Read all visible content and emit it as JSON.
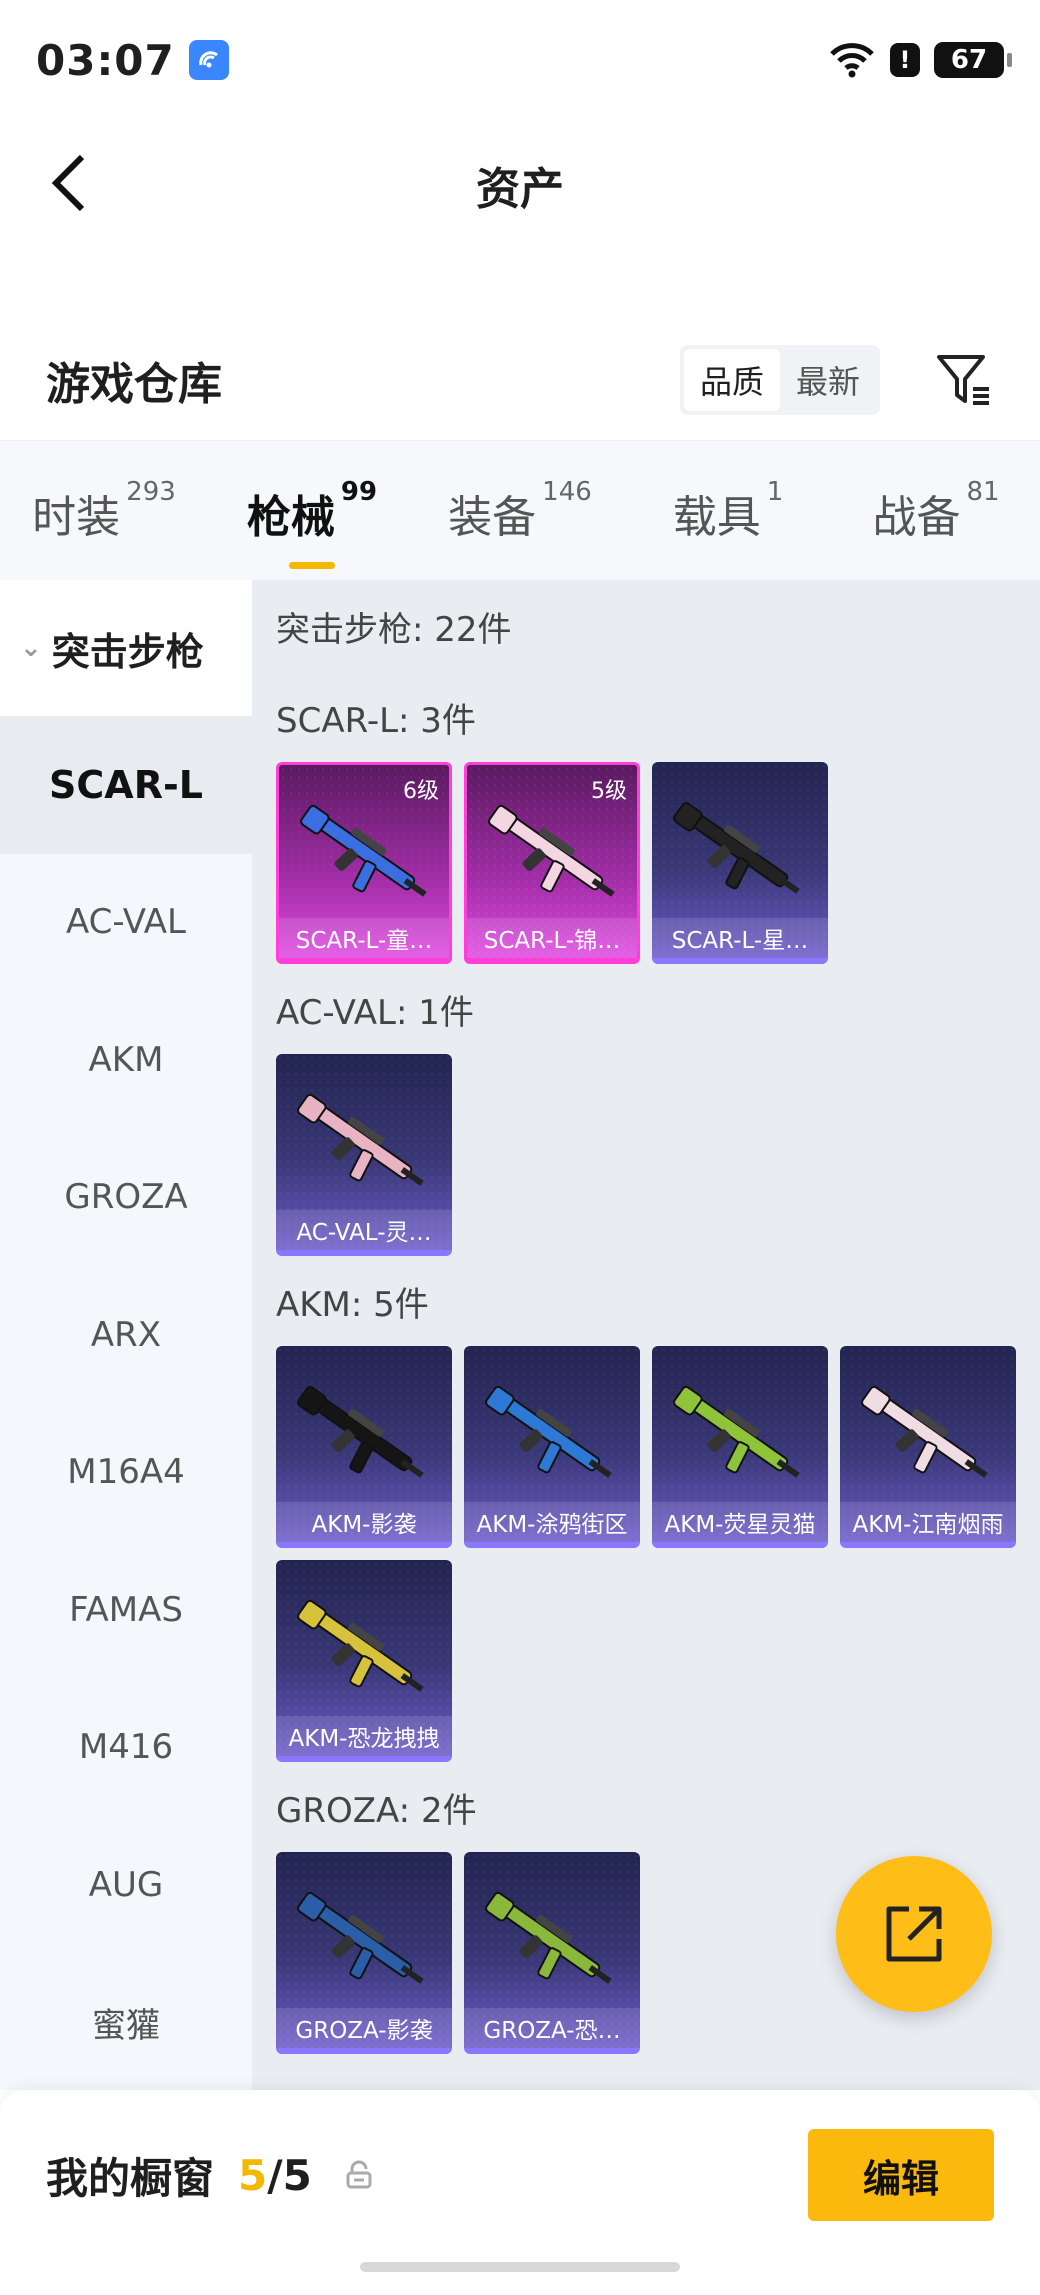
{
  "status_bar": {
    "time": "03:07",
    "battery": "67",
    "icons": [
      "app-notification-icon",
      "wifi-icon",
      "alert-icon",
      "battery-icon"
    ]
  },
  "header": {
    "title": "资产"
  },
  "warehouse": {
    "title": "游戏仓库",
    "sort_options": [
      "品质",
      "最新"
    ],
    "sort_selected": "品质"
  },
  "tabs": [
    {
      "label": "时装",
      "count": "293"
    },
    {
      "label": "枪械",
      "count": "99",
      "active": true
    },
    {
      "label": "装备",
      "count": "146"
    },
    {
      "label": "载具",
      "count": "1"
    },
    {
      "label": "战备",
      "count": "81"
    }
  ],
  "sidebar": {
    "group_label": "突击步枪",
    "items": [
      "SCAR-L",
      "AC-VAL",
      "AKM",
      "GROZA",
      "ARX",
      "M16A4",
      "FAMAS",
      "M416",
      "AUG",
      "蜜獾"
    ],
    "active_item": "SCAR-L"
  },
  "content": {
    "summary": "突击步枪: 22件",
    "sections": [
      {
        "label": "SCAR-L: 3件",
        "items": [
          {
            "name": "SCAR-L-童…",
            "level": "6级",
            "rarity": "pink",
            "gun_color": "#3b6ee0"
          },
          {
            "name": "SCAR-L-锦…",
            "level": "5级",
            "rarity": "pink",
            "gun_color": "#f3d6e2"
          },
          {
            "name": "SCAR-L-星…",
            "level": "",
            "rarity": "purple",
            "gun_color": "#222222"
          }
        ]
      },
      {
        "label": "AC-VAL: 1件",
        "items": [
          {
            "name": "AC-VAL-灵…",
            "level": "",
            "rarity": "purple",
            "gun_color": "#e8b4c4"
          }
        ]
      },
      {
        "label": "AKM: 5件",
        "items": [
          {
            "name": "AKM-影袭",
            "level": "",
            "rarity": "purple",
            "gun_color": "#151515"
          },
          {
            "name": "AKM-涂鸦街区",
            "level": "",
            "rarity": "purple",
            "gun_color": "#2f79d6"
          },
          {
            "name": "AKM-荧星灵猫",
            "level": "",
            "rarity": "purple",
            "gun_color": "#8ec33a"
          },
          {
            "name": "AKM-江南烟雨",
            "level": "",
            "rarity": "purple",
            "gun_color": "#f0dde3"
          },
          {
            "name": "AKM-恐龙拽拽",
            "level": "",
            "rarity": "purple",
            "gun_color": "#d7c23b"
          }
        ]
      },
      {
        "label": "GROZA: 2件",
        "items": [
          {
            "name": "GROZA-影袭",
            "level": "",
            "rarity": "purple",
            "gun_color": "#2b5ea8"
          },
          {
            "name": "GROZA-恐…",
            "level": "",
            "rarity": "purple",
            "gun_color": "#8ab83a"
          }
        ]
      }
    ]
  },
  "showcase": {
    "title": "我的橱窗",
    "current": "5",
    "separator": "/",
    "total": "5",
    "edit_label": "编辑"
  },
  "colors": {
    "accent": "#f5b800",
    "fab": "#ffbd18",
    "edit_button": "#fbb80d",
    "pink_border": "#ff3fd8",
    "purple_border": "#8b77ff"
  }
}
